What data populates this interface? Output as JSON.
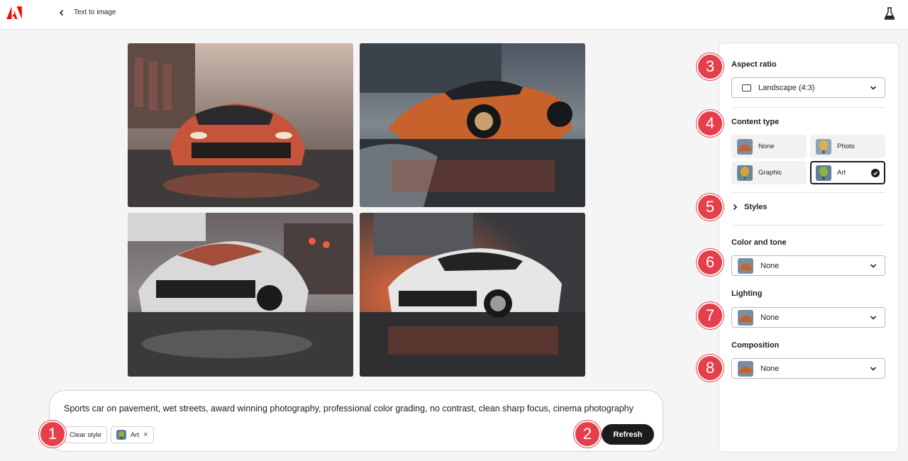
{
  "header": {
    "title": "Text to image"
  },
  "images": [
    {
      "name": "generated-image-1",
      "palette": [
        "#5b5552",
        "#c25039",
        "#e9c6b0"
      ]
    },
    {
      "name": "generated-image-2",
      "palette": [
        "#3d4550",
        "#c8622c",
        "#dfe3e6"
      ]
    },
    {
      "name": "generated-image-3",
      "palette": [
        "#4d4d50",
        "#d9d9d9",
        "#9a3f33"
      ]
    },
    {
      "name": "generated-image-4",
      "palette": [
        "#3a3a3e",
        "#e6e6e6",
        "#d24a2c"
      ]
    }
  ],
  "prompt": {
    "text": "Sports car on pavement, wet streets, award winning photography, professional color grading, no contrast, clean sharp focus, cinema photography",
    "clear_style_label": "Clear style",
    "style_chip_label": "Art",
    "style_chip_remove": "×",
    "refresh_label": "Refresh"
  },
  "badges": [
    "1",
    "2",
    "3",
    "4",
    "5",
    "6",
    "7",
    "8"
  ],
  "panel": {
    "aspect_ratio": {
      "label": "Aspect ratio",
      "value": "Landscape (4:3)"
    },
    "content_type": {
      "label": "Content type",
      "options": [
        {
          "label": "None",
          "selected": false
        },
        {
          "label": "Photo",
          "selected": false
        },
        {
          "label": "Graphic",
          "selected": false
        },
        {
          "label": "Art",
          "selected": true
        }
      ]
    },
    "styles": {
      "label": "Styles"
    },
    "color_and_tone": {
      "label": "Color and tone",
      "value": "None"
    },
    "lighting": {
      "label": "Lighting",
      "value": "None"
    },
    "composition": {
      "label": "Composition",
      "value": "None"
    }
  },
  "colors": {
    "accent_badge": "#e43f4b",
    "adobe_red": "#eb1000",
    "button_dark": "#1c1c1c"
  }
}
